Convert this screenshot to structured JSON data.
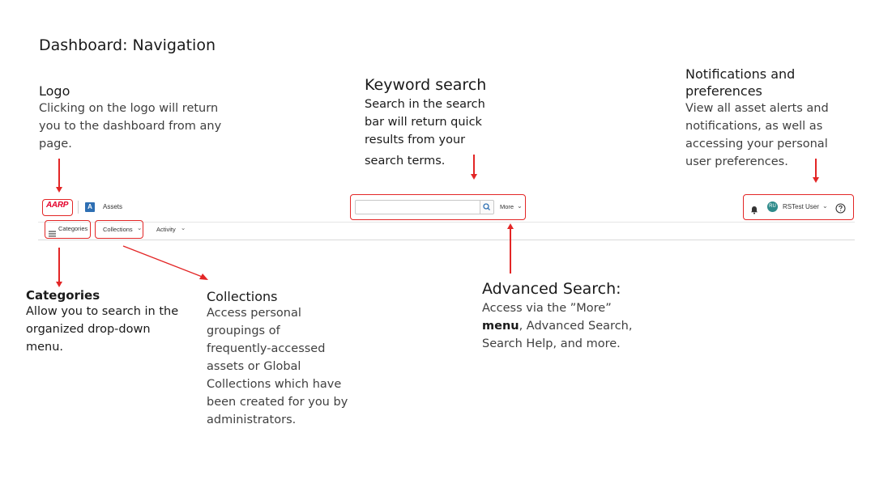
{
  "slide": {
    "title": "Dashboard: Navigation"
  },
  "annotations": {
    "logo": {
      "title": "Logo",
      "lines": [
        "Clicking on the logo will  return",
        "you to the dashboard from any",
        "page."
      ]
    },
    "keyword_search": {
      "title": "Keyword search",
      "lines": [
        "Search in the search",
        "bar will return quick",
        "results from your",
        "search terms."
      ]
    },
    "notifications": {
      "title_lines": [
        "Notifications and",
        "preferences"
      ],
      "lines": [
        "View all asset alerts and",
        "notifications, as well as",
        "accessing your personal",
        "user preferences."
      ]
    },
    "categories": {
      "title": "Categories",
      "lines": [
        "Allow you to search in the",
        "organized drop-down",
        "menu."
      ]
    },
    "collections": {
      "title": "Collections",
      "lines": [
        "Access personal",
        "groupings of",
        "frequently-accessed",
        "assets or Global",
        "Collections which have",
        "been created for you  by",
        "administrators."
      ]
    },
    "advanced_search": {
      "title": "Advanced Search:",
      "line1": "Access via the ”More”",
      "line2_bold": "menu",
      "line2_rest": ", Advanced Search,",
      "line3": "Search Help, and more."
    }
  },
  "header": {
    "logo_text": "AARP",
    "app_badge": "A",
    "app_name": "Assets",
    "search": {
      "placeholder": "",
      "value": ""
    },
    "more_label": "More",
    "user": {
      "initials": "RU",
      "name": "RSTest User"
    },
    "icons": [
      "bell-icon",
      "help-icon",
      "search-icon",
      "chevron-down-icon",
      "hamburger-icon"
    ]
  },
  "subnav": {
    "categories_label": "Categories",
    "collections_label": "Collections",
    "activity_label": "Activity"
  },
  "colors": {
    "highlight": "#e32626",
    "brand": "#e4002b",
    "badge": "#2e6fb3",
    "avatar": "#2e8b8b"
  }
}
